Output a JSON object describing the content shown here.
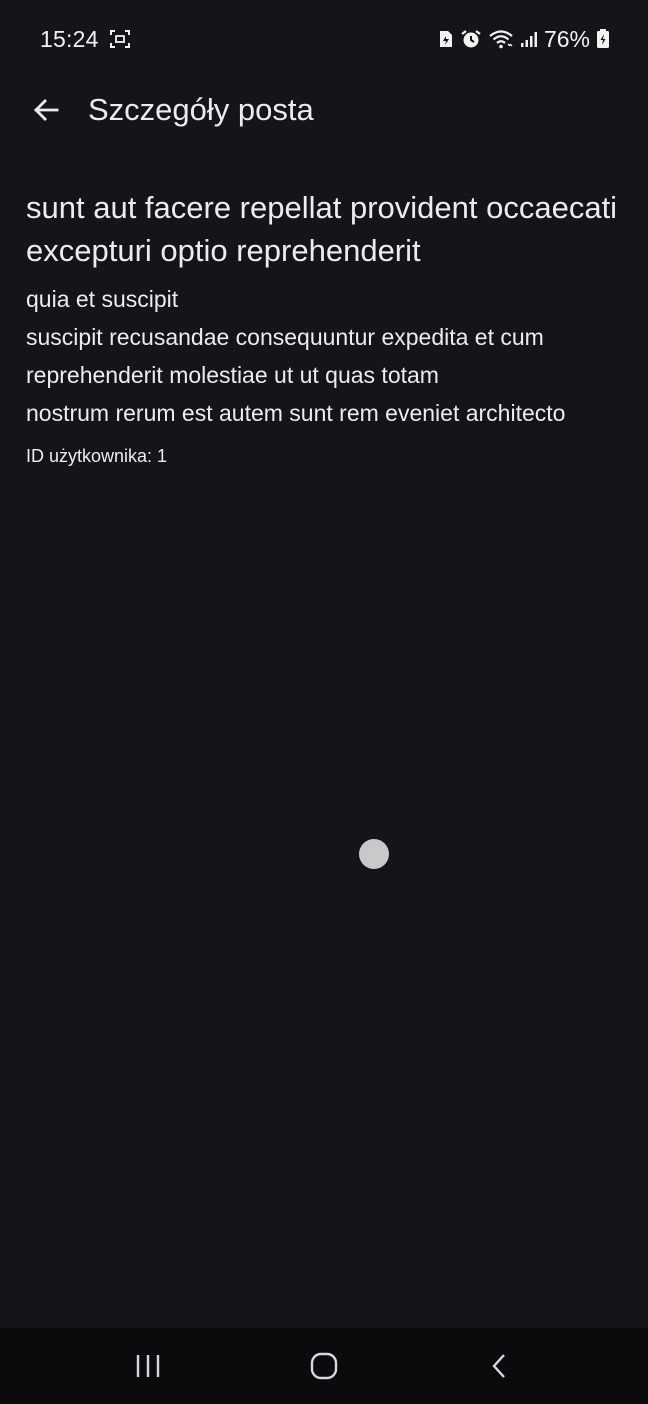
{
  "status_bar": {
    "time": "15:24",
    "battery_text": "76%",
    "icons": [
      "screenshot-icon",
      "sim-icon",
      "alarm-icon",
      "wifi-icon",
      "signal-icon",
      "battery-icon"
    ]
  },
  "app_bar": {
    "back_icon": "arrow-left-icon",
    "title": "Szczegóły posta"
  },
  "post": {
    "title": "sunt aut facere repellat provident occaecati excepturi optio reprehenderit",
    "body": "quia et suscipit\nsuscipit recusandae consequuntur expedita et cum\nreprehenderit molestiae ut ut quas totam\nnostrum rerum est autem sunt rem eveniet architecto",
    "user_label": "ID użytkownika: 1"
  },
  "nav_bar": {
    "icons": [
      "recent-apps-icon",
      "home-icon",
      "back-icon"
    ]
  },
  "colors": {
    "background": "#141419",
    "text": "#ecebf1",
    "nav_background": "#0b0b0e"
  }
}
